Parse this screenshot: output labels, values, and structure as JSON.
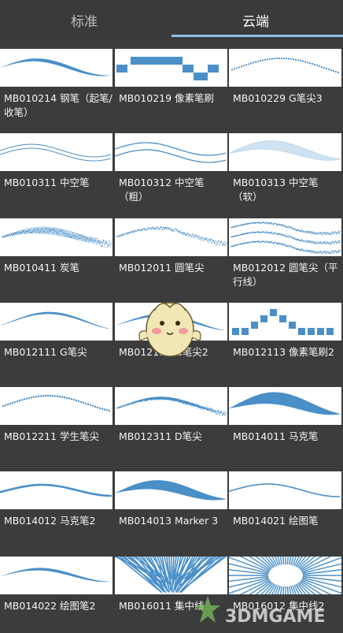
{
  "tabs": {
    "standard": "标准",
    "cloud": "云端"
  },
  "brushes": [
    {
      "label": "MB010214 钢笔（起笔/收笔）",
      "style": "pen"
    },
    {
      "label": "MB010219 像素笔刷",
      "style": "pixel-steps"
    },
    {
      "label": "MB010229 G笔尖3",
      "style": "gpen-dotted"
    },
    {
      "label": "MB010311 中空笔",
      "style": "hollow"
    },
    {
      "label": "MB010312 中空笔（粗）",
      "style": "hollow-thick"
    },
    {
      "label": "MB010313 中空笔（软）",
      "style": "hollow-soft"
    },
    {
      "label": "MB010411 炭笔",
      "style": "charcoal"
    },
    {
      "label": "MB012011 圆笔尖",
      "style": "round-rough"
    },
    {
      "label": "MB012012 圆笔尖（平行线）",
      "style": "parallel"
    },
    {
      "label": "MB012111 G笔尖",
      "style": "gpen"
    },
    {
      "label": "MB012112 G笔尖2",
      "style": "gpen2"
    },
    {
      "label": "MB012113 像素笔刷2",
      "style": "pixel-squares"
    },
    {
      "label": "MB012211 学生笔尖",
      "style": "student"
    },
    {
      "label": "MB012311 D笔尖",
      "style": "dpen"
    },
    {
      "label": "MB014011 马克笔",
      "style": "marker-thick"
    },
    {
      "label": "MB014012 马克笔2",
      "style": "marker2"
    },
    {
      "label": "MB014013 Marker 3",
      "style": "marker3"
    },
    {
      "label": "MB014021 绘图笔",
      "style": "drawing"
    },
    {
      "label": "MB014022 绘图笔2",
      "style": "drawing2"
    },
    {
      "label": "MB016011 集中线",
      "style": "focus-lines"
    },
    {
      "label": "MB016012 集中线2",
      "style": "focus-lines2"
    }
  ],
  "colors": {
    "stroke": "#4a8fc7",
    "accent": "#8ec3e6",
    "background": "#3c3c3c"
  },
  "watermark": "3DMGAME"
}
